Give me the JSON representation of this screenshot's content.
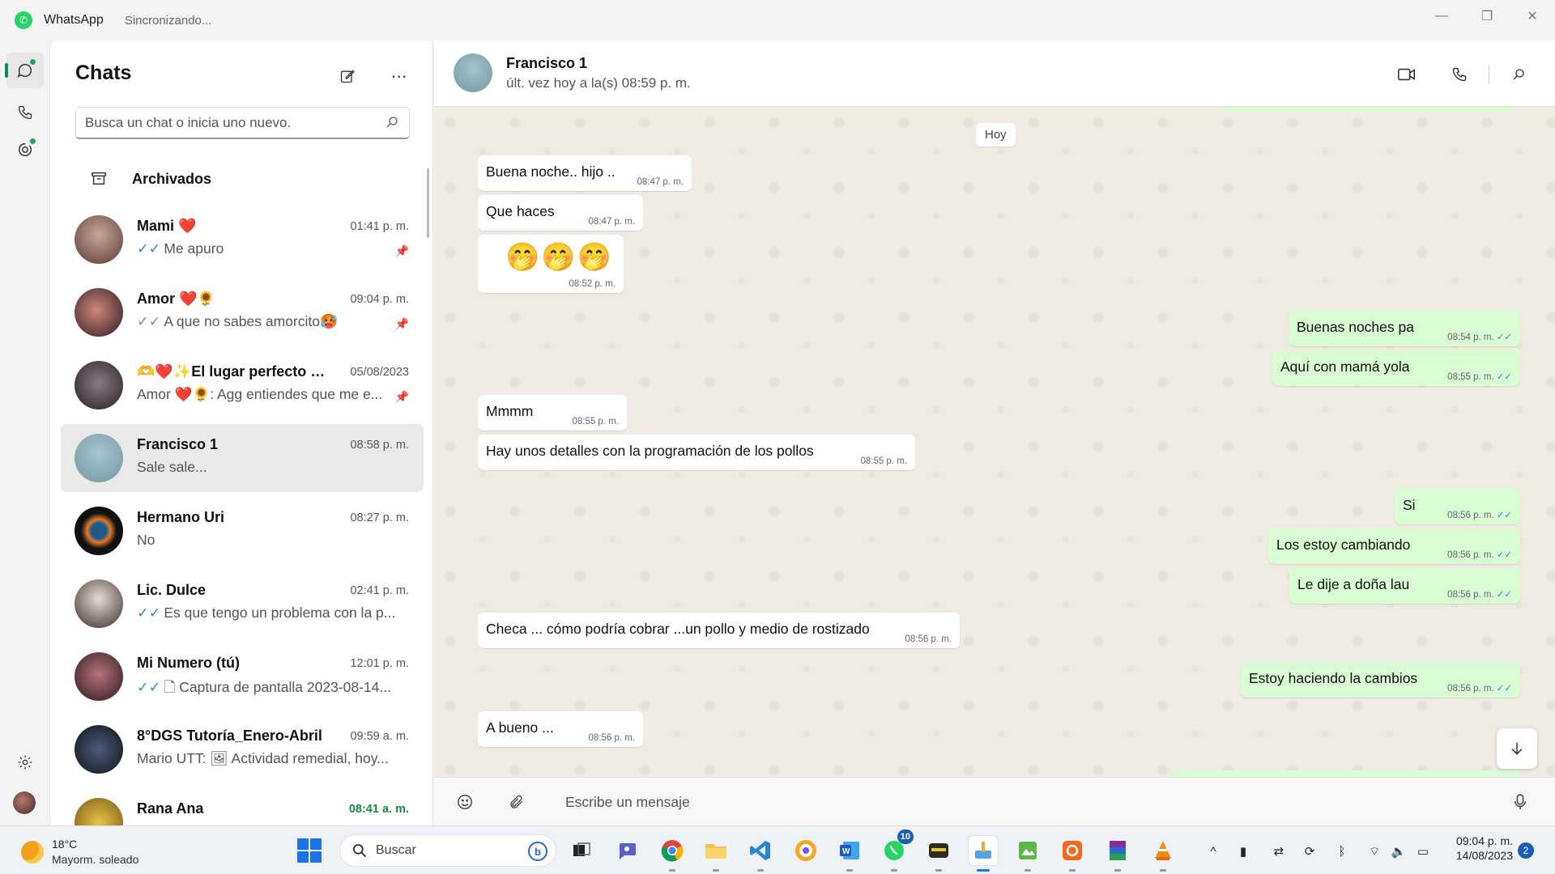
{
  "titlebar": {
    "app_name": "WhatsApp",
    "status": "Sincronizando..."
  },
  "rail": {
    "items": [
      "chats-icon",
      "calls-icon",
      "status-icon"
    ],
    "bottom": [
      "settings-icon",
      "profile-avatar"
    ]
  },
  "chatlist": {
    "title": "Chats",
    "search_placeholder": "Busca un chat o inicia uno nuevo.",
    "archived_label": "Archivados",
    "items": [
      {
        "name": "Mami ❤️",
        "time": "01:41 p. m.",
        "ticks": "✓✓",
        "preview": "Me apuro",
        "pinned": true
      },
      {
        "name": "Amor ❤️🌻",
        "time": "09:04 p. m.",
        "ticks": "✓✓",
        "preview": "A que no sabes amorcito🥵",
        "pinned": true
      },
      {
        "name": "🫶❤️✨El lugar perfecto ✨...",
        "time": "05/08/2023",
        "ticks": "",
        "preview": "Amor ❤️🌻: Agg entiendes que me e...",
        "pinned": true
      },
      {
        "name": "Francisco 1",
        "time": "08:58 p. m.",
        "ticks": "",
        "preview": "Sale sale...",
        "pinned": false
      },
      {
        "name": "Hermano Uri",
        "time": "08:27 p. m.",
        "ticks": "",
        "preview": "No",
        "pinned": false
      },
      {
        "name": "Lic. Dulce",
        "time": "02:41 p. m.",
        "ticks": "✓✓",
        "preview": "Es que tengo un problema con la p...",
        "pinned": false
      },
      {
        "name": "Mi Numero (tú)",
        "time": "12:01 p. m.",
        "ticks": "✓✓",
        "preview": "🗋 Captura de pantalla 2023-08-14...",
        "pinned": false
      },
      {
        "name": "8°DGS Tutoría_Enero-Abril",
        "time": "09:59 a. m.",
        "ticks": "",
        "preview": "Mario UTT: 🖼 Actividad remedial, hoy...",
        "pinned": false
      },
      {
        "name": "Rana Ana",
        "time": "08:41 a. m.",
        "ticks": "",
        "preview": "",
        "pinned": false
      }
    ]
  },
  "conversation": {
    "contact_name": "Francisco 1",
    "last_seen": "últ. vez hoy a la(s) 08:59 p. m.",
    "date_chip": "Hoy",
    "messages": [
      {
        "dir": "in",
        "text": "Buena noche.. hijo ..",
        "time": "08:47 p. m."
      },
      {
        "dir": "in",
        "text": "Que haces",
        "time": "08:47 p. m."
      },
      {
        "dir": "in",
        "text": "🤭🤭🤭",
        "time": "08:52 p. m."
      },
      {
        "dir": "out",
        "text": "Buenas noches pa",
        "time": "08:54 p. m.",
        "ticks": "✓✓"
      },
      {
        "dir": "out",
        "text": "Aquí con mamá yola",
        "time": "08:55 p. m.",
        "ticks": "✓✓"
      },
      {
        "dir": "in",
        "text": "Mmmm",
        "time": "08:55 p. m."
      },
      {
        "dir": "in",
        "text": "Hay unos detalles con la programación de los pollos",
        "time": "08:55 p. m."
      },
      {
        "dir": "out",
        "text": "Si",
        "time": "08:56 p. m.",
        "ticks": "✓✓"
      },
      {
        "dir": "out",
        "text": "Los estoy cambiando",
        "time": "08:56 p. m.",
        "ticks": "✓✓"
      },
      {
        "dir": "out",
        "text": "Le dije a doña lau",
        "time": "08:56 p. m.",
        "ticks": "✓✓"
      },
      {
        "dir": "in",
        "text": "Checa ... cómo podría cobrar ...un pollo y medio de rostizado",
        "time": "08:56 p. m."
      },
      {
        "dir": "out",
        "text": "Estoy haciendo la cambios",
        "time": "08:56 p. m.",
        "ticks": "✓✓"
      },
      {
        "dir": "in",
        "text": "A bueno ...",
        "time": "08:56 p. m."
      }
    ],
    "composer_placeholder": "Escribe un mensaje"
  },
  "taskbar": {
    "weather_temp": "18°C",
    "weather_condition": "Mayorm. soleado",
    "search_label": "Buscar",
    "apps": [
      "task-view",
      "teams",
      "chrome",
      "file-explorer",
      "vscode",
      "canva",
      "word",
      "whatsapp",
      "game",
      "paint",
      "excel-like",
      "app-orange",
      "winrar",
      "vlc"
    ],
    "whatsapp_badge": "10",
    "time": "09:04 p. m.",
    "date": "14/08/2023",
    "notifications": "2"
  },
  "colors": {
    "accent": "#0b8a5a",
    "outgoing_bubble": "#d9fdd3",
    "tick_blue": "#2a8bd8",
    "unread_green": "#138d43"
  }
}
